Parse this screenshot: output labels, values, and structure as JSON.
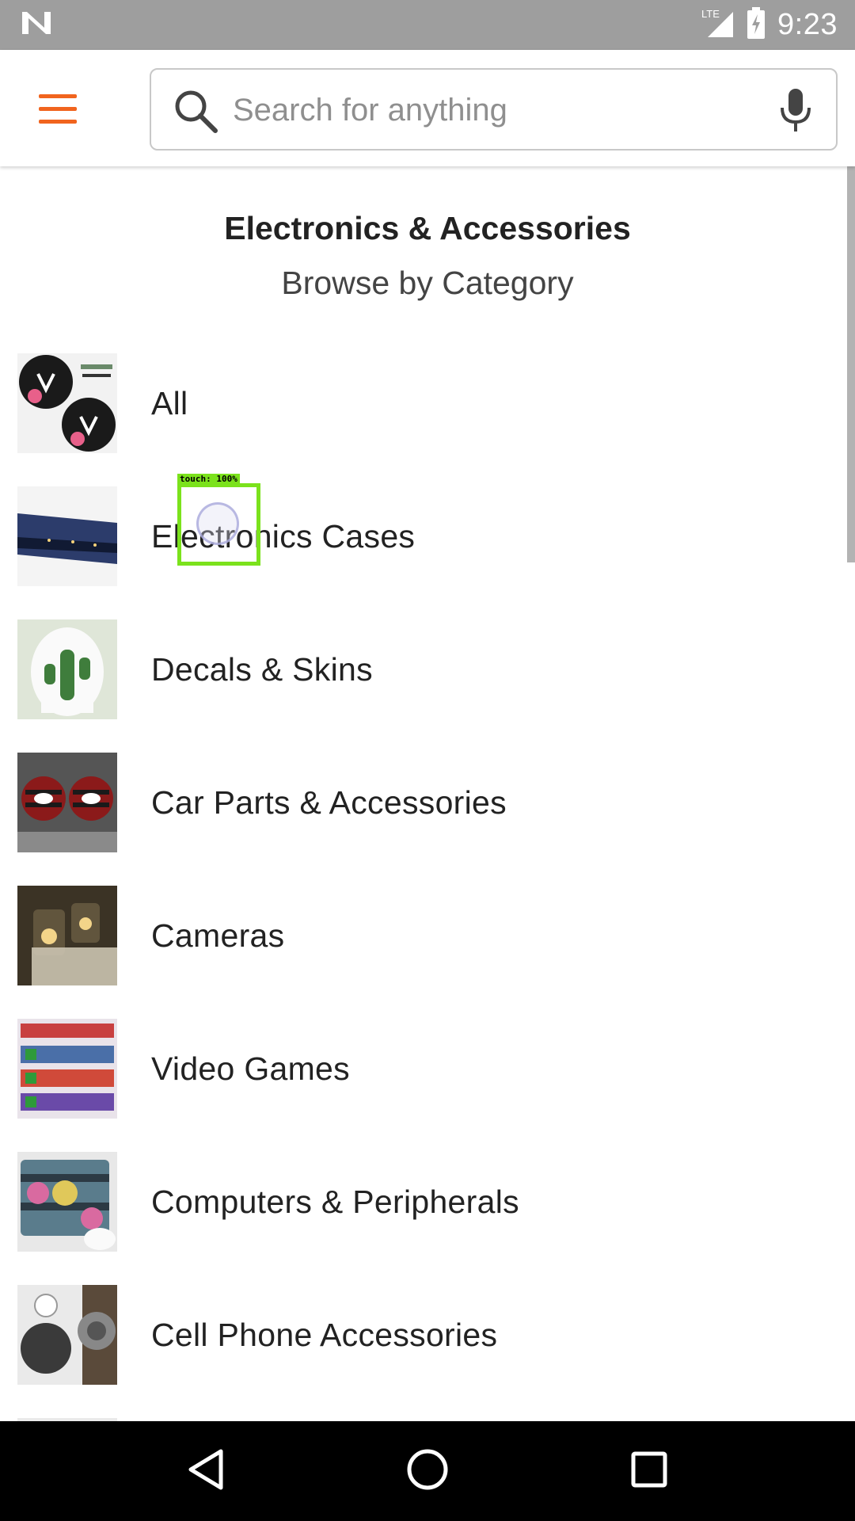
{
  "status_bar": {
    "network": "LTE",
    "time": "9:23"
  },
  "search": {
    "placeholder": "Search for anything",
    "value": ""
  },
  "header": {
    "title": "Electronics & Accessories",
    "subtitle": "Browse by Category"
  },
  "categories": [
    {
      "label": "All",
      "thumb_color": "#1a1a1a"
    },
    {
      "label": "Electronics Cases",
      "thumb_color": "#2c3c6b"
    },
    {
      "label": "Decals & Skins",
      "thumb_color": "#3f7d3c"
    },
    {
      "label": "Car Parts & Accessories",
      "thumb_color": "#8b1a1a"
    },
    {
      "label": "Cameras",
      "thumb_color": "#3b3325"
    },
    {
      "label": "Video Games",
      "thumb_color": "#4a6fa8"
    },
    {
      "label": "Computers & Peripherals",
      "thumb_color": "#5a7c8c"
    },
    {
      "label": "Cell Phone Accessories",
      "thumb_color": "#444444"
    }
  ],
  "touch_indicator": {
    "label": "touch: 100%"
  },
  "colors": {
    "accent": "#f1641e",
    "status_bar": "#9e9e9e",
    "nav_bar": "#000000"
  }
}
